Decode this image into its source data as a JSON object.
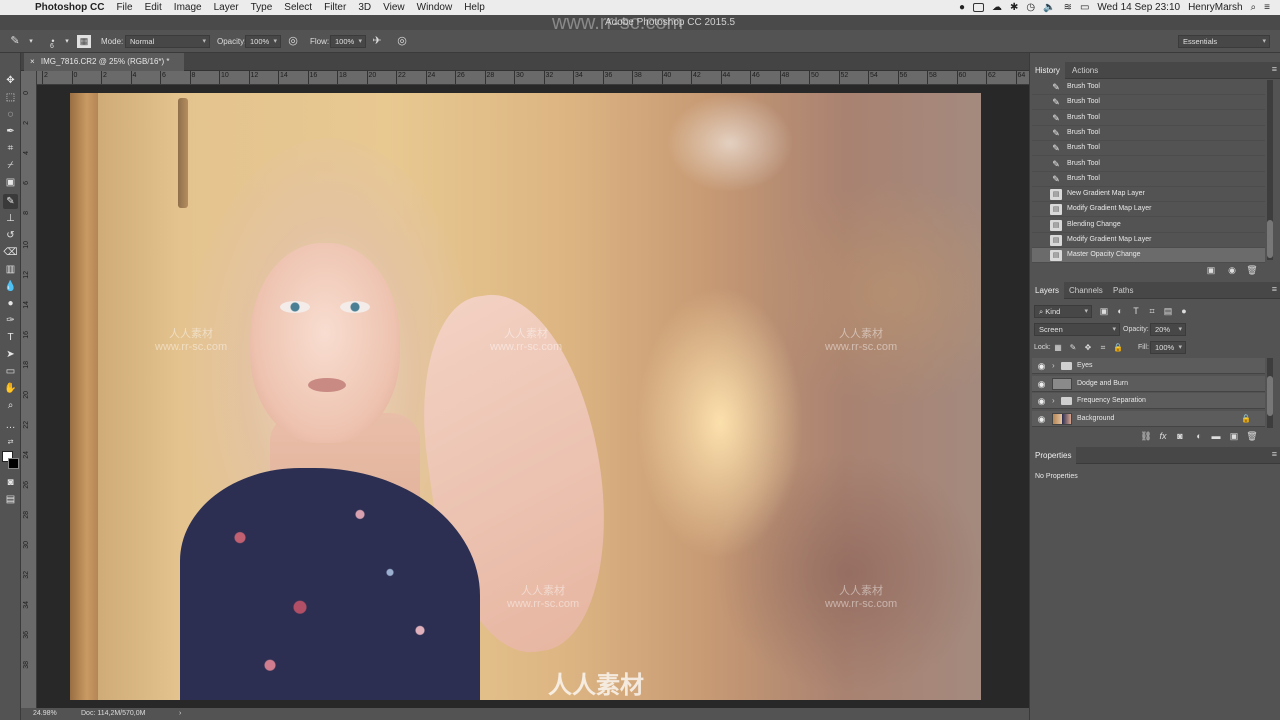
{
  "menubar": {
    "app_name": "Photoshop CC",
    "items": [
      "File",
      "Edit",
      "Image",
      "Layer",
      "Type",
      "Select",
      "Filter",
      "3D",
      "View",
      "Window",
      "Help"
    ],
    "clock": "Wed 14 Sep  23:10",
    "user": "HenryMarsh"
  },
  "window_title": "Adobe Photoshop CC 2015.5",
  "options": {
    "brush_size": "6",
    "mode_label": "Mode:",
    "mode_value": "Normal",
    "opacity_label": "Opacity:",
    "opacity_value": "100%",
    "flow_label": "Flow:",
    "flow_value": "100%",
    "workspace": "Essentials"
  },
  "document": {
    "tab_title": "IMG_7816.CR2 @ 25% (RGB/16*) *",
    "ruler_top": [
      "2",
      "0",
      "2",
      "4",
      "6",
      "8",
      "10",
      "12",
      "14",
      "16",
      "18",
      "20",
      "22",
      "24",
      "26",
      "28",
      "30",
      "32",
      "34",
      "36",
      "38",
      "40",
      "42",
      "44",
      "46",
      "48",
      "50",
      "52",
      "54",
      "56",
      "58",
      "60",
      "62",
      "64"
    ],
    "ruler_left": [
      "0",
      "2",
      "4",
      "6",
      "8",
      "10",
      "12",
      "14",
      "16",
      "18",
      "20",
      "22",
      "24",
      "26",
      "28",
      "30",
      "32",
      "34",
      "36",
      "38"
    ]
  },
  "status": {
    "zoom": "24.98%",
    "doc_size": "Doc: 114,2M/570,0M"
  },
  "watermarks": {
    "cn": "人人素材",
    "url": "www.rr-sc.com",
    "title_overlay": "www.rr-sc.com",
    "bottom_logo": "人人素材"
  },
  "history_panel": {
    "tabs": [
      "History",
      "Actions"
    ],
    "items": [
      {
        "label": "Brush Tool",
        "icon": "brush-icon"
      },
      {
        "label": "Brush Tool",
        "icon": "brush-icon"
      },
      {
        "label": "Brush Tool",
        "icon": "brush-icon"
      },
      {
        "label": "Brush Tool",
        "icon": "brush-icon"
      },
      {
        "label": "Brush Tool",
        "icon": "brush-icon"
      },
      {
        "label": "Brush Tool",
        "icon": "brush-icon"
      },
      {
        "label": "Brush Tool",
        "icon": "brush-icon"
      },
      {
        "label": "New Gradient Map Layer",
        "icon": "document-icon"
      },
      {
        "label": "Modify Gradient Map Layer",
        "icon": "document-icon"
      },
      {
        "label": "Blending Change",
        "icon": "document-icon"
      },
      {
        "label": "Modify Gradient Map Layer",
        "icon": "document-icon"
      },
      {
        "label": "Master Opacity Change",
        "icon": "document-icon"
      }
    ],
    "selected_index": 11
  },
  "layers_panel": {
    "tabs": [
      "Layers",
      "Channels",
      "Paths"
    ],
    "filter_kind": "Kind",
    "blend_mode": "Screen",
    "opacity_label": "Opacity:",
    "opacity_value": "20%",
    "lock_label": "Lock:",
    "fill_label": "Fill:",
    "fill_value": "100%",
    "layers": [
      {
        "name": "Eyes",
        "type": "group"
      },
      {
        "name": "Dodge and Burn",
        "type": "layer"
      },
      {
        "name": "Frequency Separation",
        "type": "group"
      },
      {
        "name": "Background",
        "type": "image",
        "locked": true
      }
    ]
  },
  "properties_panel": {
    "tab": "Properties",
    "message": "No Properties"
  }
}
